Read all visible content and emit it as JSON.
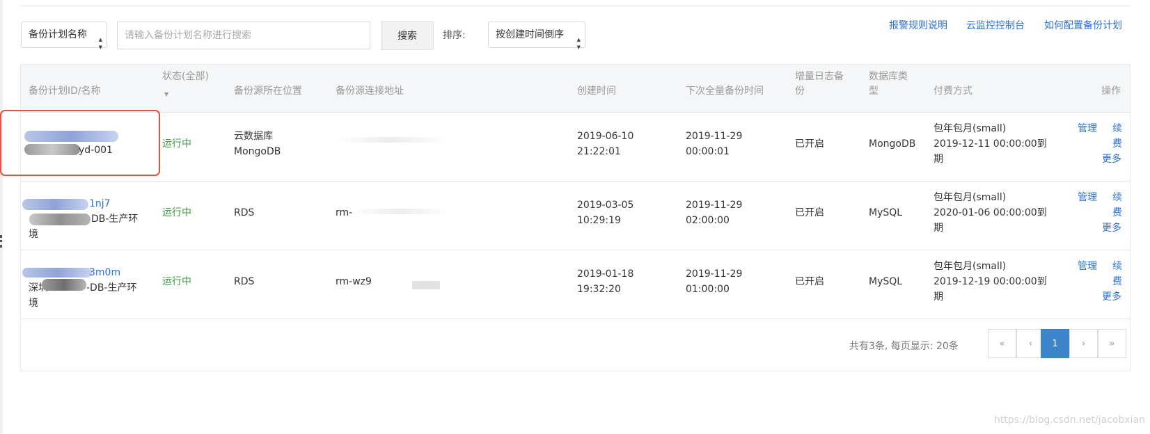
{
  "toolbar": {
    "filter_select": "备份计划名称",
    "search_placeholder": "请输入备份计划名称进行搜索",
    "search_button": "搜索",
    "sort_label": "排序:",
    "sort_select": "按创建时间倒序"
  },
  "top_links": [
    "报警规则说明",
    "云监控控制台",
    "如何配置备份计划"
  ],
  "table": {
    "headers": {
      "id_name": "备份计划ID/名称",
      "status": "状态(全部)",
      "location": "备份源所在位置",
      "address": "备份源连接地址",
      "created": "创建时间",
      "next_backup": "下次全量备份时间",
      "incr_log_1": "增量日志备",
      "incr_log_2": "份",
      "db_type_1": "数据库类",
      "db_type_2": "型",
      "billing": "付费方式",
      "actions": "操作"
    },
    "rows": [
      {
        "id": "",
        "name": "yd-001",
        "status": "运行中",
        "location_1": "云数据库",
        "location_2": "MongoDB",
        "address": "",
        "created_date": "2019-06-10",
        "created_time": "21:22:01",
        "next_date": "2019-11-29",
        "next_time": "00:00:01",
        "incr_log": "已开启",
        "db_type": "MongoDB",
        "billing_1": "包年包月(small)",
        "billing_2": "2019-12-11 00:00:00到",
        "billing_3": "期",
        "manage": "管理",
        "renew_1": "续",
        "renew_2": "费",
        "more": "更多"
      },
      {
        "id": "1nj7",
        "name": "DB-生产环",
        "name_2": "境",
        "status": "运行中",
        "location_1": "RDS",
        "location_2": "",
        "address": "rm-",
        "created_date": "2019-03-05",
        "created_time": "10:29:19",
        "next_date": "2019-11-29",
        "next_time": "02:00:00",
        "incr_log": "已开启",
        "db_type": "MySQL",
        "billing_1": "包年包月(small)",
        "billing_2": "2020-01-06 00:00:00到",
        "billing_3": "期",
        "manage": "管理",
        "renew_1": "续",
        "renew_2": "费",
        "more": "更多"
      },
      {
        "id": "3m0m",
        "name": "深圳",
        "name_b": "-DB-生产环",
        "name_2": "境",
        "status": "运行中",
        "location_1": "RDS",
        "location_2": "",
        "address": "rm-wz9",
        "created_date": "2019-01-18",
        "created_time": "19:32:20",
        "next_date": "2019-11-29",
        "next_time": "01:00:00",
        "incr_log": "已开启",
        "db_type": "MySQL",
        "billing_1": "包年包月(small)",
        "billing_2": "2019-12-19 00:00:00到",
        "billing_3": "期",
        "manage": "管理",
        "renew_1": "续",
        "renew_2": "费",
        "more": "更多"
      }
    ]
  },
  "pagination": {
    "summary": "共有3条, 每页显示: 20条",
    "first": "«",
    "prev": "‹",
    "current": "1",
    "next": "›",
    "last": "»"
  },
  "watermark": "https://blog.csdn.net/jacobxian",
  "colors": {
    "link": "#2a6fd6",
    "status_running": "#3d9a3d",
    "highlight": "#e0533d",
    "page_active": "#3c85c8"
  }
}
